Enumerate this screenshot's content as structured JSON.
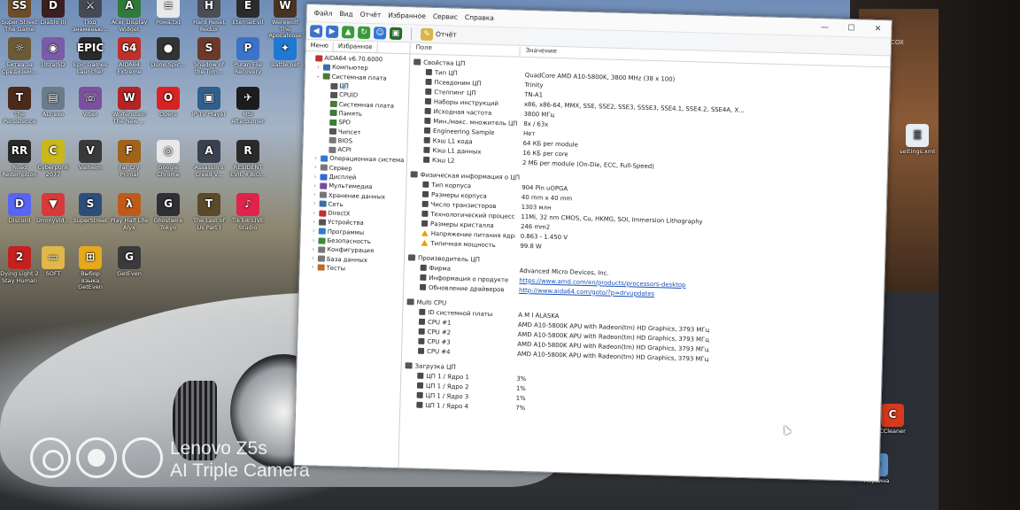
{
  "desktop": {
    "icons": [
      {
        "label": "Super Street The Game",
        "color": "#6b4d2a",
        "glyph": "SS"
      },
      {
        "label": "Diablo III",
        "color": "#3a1f1f",
        "glyph": "D"
      },
      {
        "label": "Под знаменью...",
        "color": "#444a55",
        "glyph": "⚔"
      },
      {
        "label": "Acer Display Widget",
        "color": "#2f7a3a",
        "glyph": "A"
      },
      {
        "label": "Рома.txt",
        "color": "#e9e9e9",
        "glyph": "≡"
      },
      {
        "label": "Hard Reset Redux",
        "color": "#4a4d52",
        "glyph": "H"
      },
      {
        "label": "EternalEvil",
        "color": "#2b2b2b",
        "glyph": "E"
      },
      {
        "label": "Werewolf The Apocalypse",
        "color": "#4a3322",
        "glyph": "W"
      },
      {
        "label": "Битва за Средизем...",
        "color": "#6a5a38",
        "glyph": "☼"
      },
      {
        "label": "UltraISO",
        "color": "#7b5aa8",
        "glyph": "◉"
      },
      {
        "label": "Epic Games Launcher",
        "color": "#2a2a2a",
        "glyph": "EPIC"
      },
      {
        "label": "AIDA64 Extreme",
        "color": "#c0302a",
        "glyph": "64"
      },
      {
        "label": "Dune.Spic...",
        "color": "#333",
        "glyph": "●"
      },
      {
        "label": "Shadow of the Tom...",
        "color": "#6b3a2a",
        "glyph": "S"
      },
      {
        "label": "Puran File Recovery",
        "color": "#3b73c8",
        "glyph": "P"
      },
      {
        "label": "Battle.net",
        "color": "#1f78d1",
        "glyph": "✦"
      },
      {
        "label": "The Persistence",
        "color": "#4a2a1a",
        "glyph": "T"
      },
      {
        "label": "ALF.exe",
        "color": "#6c7b8a",
        "glyph": "▤"
      },
      {
        "label": "Viber",
        "color": "#7b519d",
        "glyph": "☏"
      },
      {
        "label": "Wolfenstein The New ...",
        "color": "#b32424",
        "glyph": "W"
      },
      {
        "label": "Opera",
        "color": "#d92323",
        "glyph": "O"
      },
      {
        "label": "IP-TV Player",
        "color": "#2f5f8a",
        "glyph": "▣"
      },
      {
        "label": "MSI Afterburner",
        "color": "#1c1c1c",
        "glyph": "✈"
      },
      {
        "label": "Road Redemption",
        "color": "#2a2a2a",
        "glyph": "RR"
      },
      {
        "label": "Cyberpunk 2077",
        "color": "#c8b81c",
        "glyph": "C"
      },
      {
        "label": "Valheim",
        "color": "#3a3a3a",
        "glyph": "V"
      },
      {
        "label": "Far Cry Primal",
        "color": "#a1621b",
        "glyph": "F"
      },
      {
        "label": "Google Chrome",
        "color": "#e8e8e8",
        "glyph": "◎"
      },
      {
        "label": "Assassin's Creed V...",
        "color": "#3a4150",
        "glyph": "A"
      },
      {
        "label": "RESIDENT EVIL 4 BIO...",
        "color": "#2a2a2a",
        "glyph": "R"
      },
      {
        "label": "Discord",
        "color": "#5865f2",
        "glyph": "D"
      },
      {
        "label": "UmmyVid...",
        "color": "#d63a3a",
        "glyph": "▼"
      },
      {
        "label": "SuperStreet",
        "color": "#2d4e7a",
        "glyph": "S"
      },
      {
        "label": "Play Half Life Alyx",
        "color": "#c05a1a",
        "glyph": "λ"
      },
      {
        "label": "Ghostwire Tokyo",
        "color": "#2f2f38",
        "glyph": "G"
      },
      {
        "label": "The Last of Us Part I",
        "color": "#5a4a2a",
        "glyph": "T"
      },
      {
        "label": "TikTok LIVE Studio",
        "color": "#e0234b",
        "glyph": "♪"
      },
      {
        "label": "Dying Light 2 Stay Human",
        "color": "#c42020",
        "glyph": "2"
      },
      {
        "label": "SOFT",
        "color": "#e0b84a",
        "glyph": "▭"
      },
      {
        "label": "Выбор языка GetEven",
        "color": "#e6a81c",
        "glyph": "⊞"
      },
      {
        "label": "GetEven",
        "color": "#3a3a3a",
        "glyph": "G"
      }
    ],
    "right_icons": [
      {
        "label": "settings.xml",
        "color": "#e6eef2",
        "glyph": "≣"
      },
      {
        "label": "CCleaner",
        "color": "#d73a1e",
        "glyph": "C"
      },
      {
        "label": "Корзина",
        "color": "#5a8fc6",
        "glyph": "♻"
      }
    ],
    "cox_label": "COX",
    "watermark": {
      "line1": "Lenovo Z5s",
      "line2": "AI Triple Camera"
    }
  },
  "window": {
    "menu": [
      "Файл",
      "Вид",
      "Отчёт",
      "Избранное",
      "Сервис",
      "Справка"
    ],
    "controls": {
      "minimize": "—",
      "maximize": "☐",
      "close": "✕"
    },
    "toolbar_report": "Отчёт",
    "left_tabs": [
      "Меню",
      "Избранное"
    ],
    "tree": [
      {
        "label": "AIDA64 v6.70.6000",
        "level": 0,
        "exp": "",
        "color": "#c0302a"
      },
      {
        "label": "Компьютер",
        "level": 1,
        "exp": "›",
        "color": "#3b6ea8"
      },
      {
        "label": "Системная плата",
        "level": 1,
        "exp": "⌄",
        "color": "#4a7a3a"
      },
      {
        "label": "ЦП",
        "level": 2,
        "exp": "",
        "color": "#555",
        "selected": true
      },
      {
        "label": "CPUID",
        "level": 2,
        "exp": "",
        "color": "#555"
      },
      {
        "label": "Системная плата",
        "level": 2,
        "exp": "",
        "color": "#4a7a3a"
      },
      {
        "label": "Память",
        "level": 2,
        "exp": "",
        "color": "#3d7a3d"
      },
      {
        "label": "SPD",
        "level": 2,
        "exp": "",
        "color": "#3d7a3d"
      },
      {
        "label": "Чипсет",
        "level": 2,
        "exp": "",
        "color": "#555"
      },
      {
        "label": "BIOS",
        "level": 2,
        "exp": "",
        "color": "#777"
      },
      {
        "label": "ACPI",
        "level": 2,
        "exp": "",
        "color": "#777"
      },
      {
        "label": "Операционная система",
        "level": 1,
        "exp": "›",
        "color": "#2f7ad1"
      },
      {
        "label": "Сервер",
        "level": 1,
        "exp": "›",
        "color": "#777"
      },
      {
        "label": "Дисплей",
        "level": 1,
        "exp": "›",
        "color": "#2f6ad1"
      },
      {
        "label": "Мультимедиа",
        "level": 1,
        "exp": "›",
        "color": "#7a4a9a"
      },
      {
        "label": "Хранение данных",
        "level": 1,
        "exp": "›",
        "color": "#777"
      },
      {
        "label": "Сеть",
        "level": 1,
        "exp": "›",
        "color": "#3b6ea8"
      },
      {
        "label": "DirectX",
        "level": 1,
        "exp": "›",
        "color": "#c0302a"
      },
      {
        "label": "Устройства",
        "level": 1,
        "exp": "›",
        "color": "#555"
      },
      {
        "label": "Программы",
        "level": 1,
        "exp": "›",
        "color": "#2f7ad1"
      },
      {
        "label": "Безопасность",
        "level": 1,
        "exp": "›",
        "color": "#3a8a3a"
      },
      {
        "label": "Конфигурация",
        "level": 1,
        "exp": "›",
        "color": "#777"
      },
      {
        "label": "База данных",
        "level": 1,
        "exp": "›",
        "color": "#777"
      },
      {
        "label": "Тесты",
        "level": 1,
        "exp": "›",
        "color": "#c06a2a"
      }
    ],
    "columns": {
      "field": "Поле",
      "value": "Значение"
    },
    "sections": [
      {
        "title": "Свойства ЦП",
        "rows": [
          {
            "field": "Тип ЦП",
            "value": "QuadCore AMD A10-5800K, 3800 MHz (38 x 100)"
          },
          {
            "field": "Псевдоним ЦП",
            "value": "Trinity"
          },
          {
            "field": "Степпинг ЦП",
            "value": "TN-A1"
          },
          {
            "field": "Наборы инструкций",
            "value": "x86, x86-64, MMX, SSE, SSE2, SSE3, SSSE3, SSE4.1, SSE4.2, SSE4A, X..."
          },
          {
            "field": "Исходная частота",
            "value": "3800 МГц"
          },
          {
            "field": "Мин./макс. множитель ЦП",
            "value": "8x / 63x"
          },
          {
            "field": "Engineering Sample",
            "value": "Нет"
          },
          {
            "field": "Кэш L1 кода",
            "value": "64 КБ per module"
          },
          {
            "field": "Кэш L1 данных",
            "value": "16 КБ per core"
          },
          {
            "field": "Кэш L2",
            "value": "2 МБ per module  (On-Die, ECC, Full-Speed)"
          }
        ]
      },
      {
        "title": "Физическая информация о ЦП",
        "rows": [
          {
            "field": "Тип корпуса",
            "value": "904 Pin uOPGA"
          },
          {
            "field": "Размеры корпуса",
            "value": "40 mm x 40 mm"
          },
          {
            "field": "Число транзисторов",
            "value": "1303 млн"
          },
          {
            "field": "Технологический процесс",
            "value": "11Mi, 32 nm CMOS, Cu, HKMG, SOI, Immersion Lithography"
          },
          {
            "field": "Размеры кристалла",
            "value": "246 mm2"
          },
          {
            "field": "Напряжение питания ядра",
            "value": "0.863 - 1.450 V",
            "warn": true
          },
          {
            "field": "Типичная мощность",
            "value": "99.8 W",
            "warn": true
          }
        ]
      },
      {
        "title": "Производитель ЦП",
        "rows": [
          {
            "field": "Фирма",
            "value": "Advanced Micro Devices, Inc."
          },
          {
            "field": "Информация о продукте",
            "value": "https://www.amd.com/en/products/processors-desktop",
            "link": true
          },
          {
            "field": "Обновление драйверов",
            "value": "http://www.aida64.com/goto/?p=drvupdates",
            "link": true
          }
        ]
      },
      {
        "title": "Multi CPU",
        "rows": [
          {
            "field": "ID системной платы",
            "value": "A M I ALASKA"
          },
          {
            "field": "CPU #1",
            "value": "AMD A10-5800K APU with Radeon(tm) HD Graphics, 3793 МГц"
          },
          {
            "field": "CPU #2",
            "value": "AMD A10-5800K APU with Radeon(tm) HD Graphics, 3793 МГц"
          },
          {
            "field": "CPU #3",
            "value": "AMD A10-5800K APU with Radeon(tm) HD Graphics, 3793 МГц"
          },
          {
            "field": "CPU #4",
            "value": "AMD A10-5800K APU with Radeon(tm) HD Graphics, 3793 МГц"
          }
        ]
      },
      {
        "title": "Загрузка ЦП",
        "rows": [
          {
            "field": "ЦП 1 / Ядро 1",
            "value": "3%"
          },
          {
            "field": "ЦП 1 / Ядро 2",
            "value": "1%"
          },
          {
            "field": "ЦП 1 / Ядро 3",
            "value": "1%"
          },
          {
            "field": "ЦП 1 / Ядро 4",
            "value": "7%"
          }
        ]
      }
    ]
  }
}
